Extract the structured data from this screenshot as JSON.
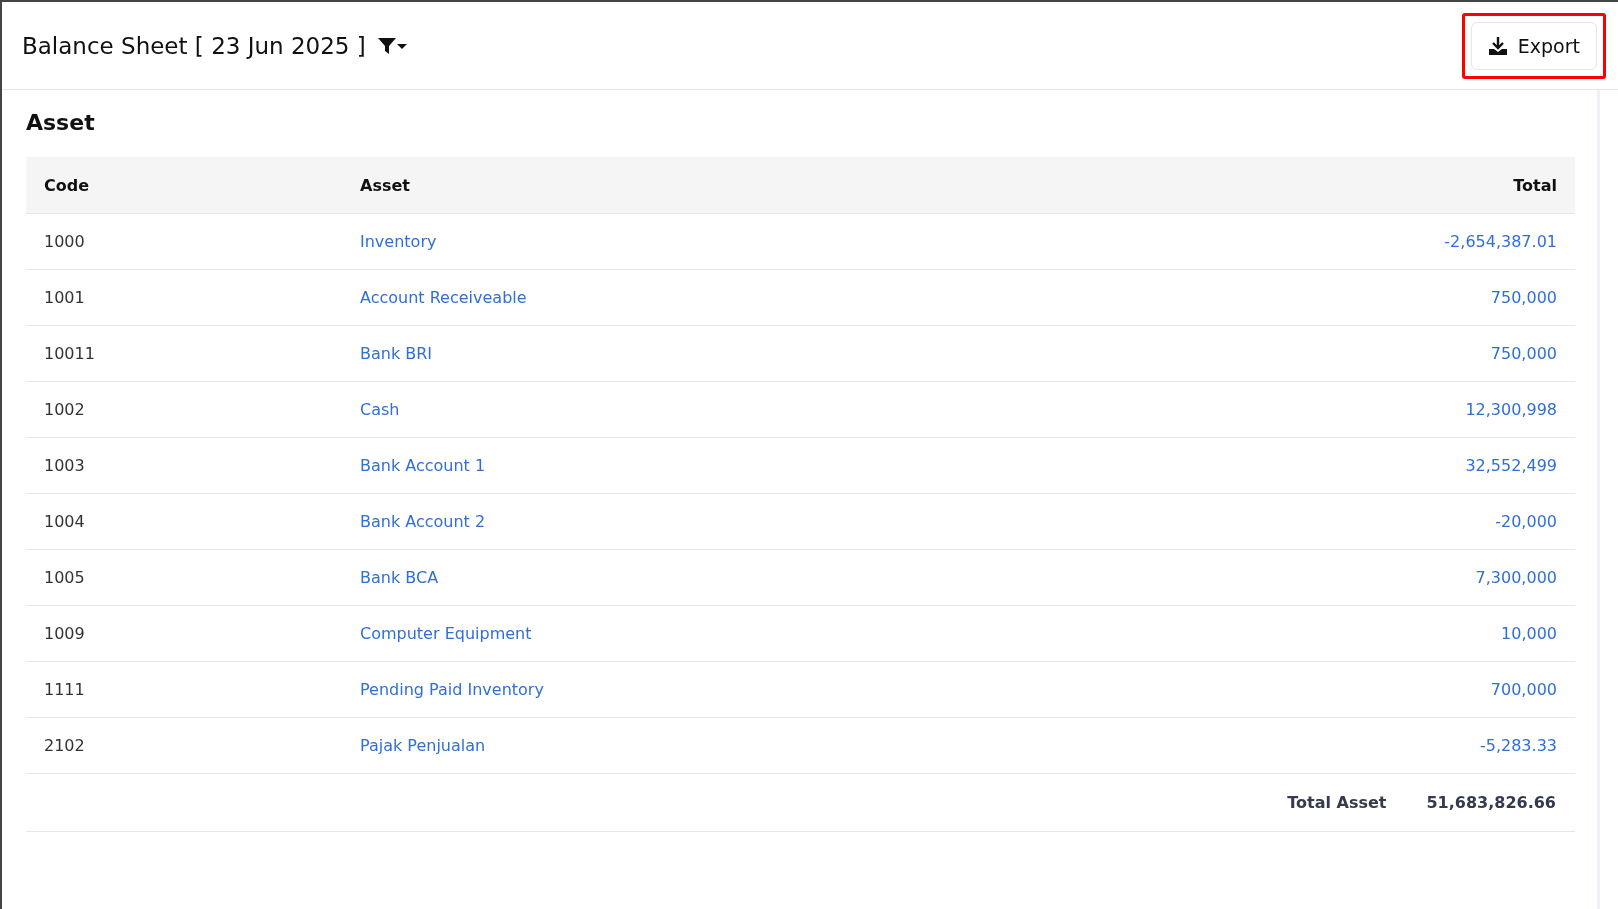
{
  "header": {
    "title": "Balance Sheet [ 23 Jun 2025 ]",
    "export_button": {
      "label": "Export",
      "highlighted": true
    }
  },
  "section": {
    "title": "Asset",
    "columns": [
      "Code",
      "Asset",
      "Total"
    ],
    "rows": [
      {
        "code": "1000",
        "name": "Inventory",
        "total": "-2,654,387.01"
      },
      {
        "code": "1001",
        "name": "Account Receiveable",
        "total": "750,000"
      },
      {
        "code": "10011",
        "name": "Bank BRI",
        "total": "750,000"
      },
      {
        "code": "1002",
        "name": "Cash",
        "total": "12,300,998"
      },
      {
        "code": "1003",
        "name": "Bank Account 1",
        "total": "32,552,499"
      },
      {
        "code": "1004",
        "name": "Bank Account 2",
        "total": "-20,000"
      },
      {
        "code": "1005",
        "name": "Bank BCA",
        "total": "7,300,000"
      },
      {
        "code": "1009",
        "name": "Computer Equipment",
        "total": "10,000"
      },
      {
        "code": "1111",
        "name": "Pending Paid Inventory",
        "total": "700,000"
      },
      {
        "code": "2102",
        "name": "Pajak Penjualan",
        "total": "-5,283.33"
      }
    ],
    "total": {
      "label": "Total Asset",
      "value": "51,683,826.66"
    }
  }
}
